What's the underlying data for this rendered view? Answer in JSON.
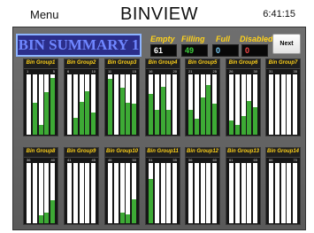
{
  "header": {
    "menu_label": "Menu",
    "title": "BINVIEW",
    "time": "6:41:15"
  },
  "summary": {
    "title": "BIN SUMMARY 1"
  },
  "stats": [
    {
      "label": "Empty",
      "value": "61",
      "color": "#ffffff"
    },
    {
      "label": "Filling",
      "value": "49",
      "color": "#3fd13f"
    },
    {
      "label": "Full",
      "value": "0",
      "color": "#7fd4ff"
    },
    {
      "label": "Disabled",
      "value": "0",
      "color": "#ff4a4a"
    }
  ],
  "next_label": "Next",
  "fill_color": "#3daa35",
  "groups": [
    {
      "name": "Bin Group1",
      "first_bin": "1",
      "last_bin": "5",
      "fill_levels": [
        0,
        0.53,
        0.16,
        0.71,
        0.94
      ]
    },
    {
      "name": "Bin Group2",
      "first_bin": "6",
      "last_bin": "10",
      "fill_levels": [
        0,
        0.28,
        0.54,
        0.72,
        0.37
      ]
    },
    {
      "name": "Bin Group3",
      "first_bin": "11",
      "last_bin": "15",
      "fill_levels": [
        0.93,
        0,
        0.78,
        0.53,
        0.51
      ]
    },
    {
      "name": "Bin Group4",
      "first_bin": "16",
      "last_bin": "20",
      "fill_levels": [
        0.68,
        0.41,
        0.79,
        0.41,
        0
      ]
    },
    {
      "name": "Bin Group5",
      "first_bin": "21",
      "last_bin": "25",
      "fill_levels": [
        0.41,
        0.26,
        0.62,
        0.82,
        0.51
      ]
    },
    {
      "name": "Bin Group6",
      "first_bin": "26",
      "last_bin": "30",
      "fill_levels": [
        0.24,
        0.16,
        0.31,
        0.56,
        0.45
      ]
    },
    {
      "name": "Bin Group7",
      "first_bin": "31",
      "last_bin": "35",
      "fill_levels": [
        0,
        0,
        0,
        0,
        0
      ]
    },
    {
      "name": "Bin Group8",
      "first_bin": "36",
      "last_bin": "40",
      "fill_levels": [
        0,
        0,
        0.13,
        0.18,
        0.38
      ]
    },
    {
      "name": "Bin Group9",
      "first_bin": "41",
      "last_bin": "45",
      "fill_levels": [
        0,
        0,
        0,
        0,
        0
      ]
    },
    {
      "name": "Bin Group10",
      "first_bin": "46",
      "last_bin": "50",
      "fill_levels": [
        0,
        0,
        0.17,
        0.14,
        0.4
      ]
    },
    {
      "name": "Bin Group11",
      "first_bin": "51",
      "last_bin": "55",
      "fill_levels": [
        0.74,
        0,
        0,
        0,
        0
      ]
    },
    {
      "name": "Bin Group12",
      "first_bin": "56",
      "last_bin": "60",
      "fill_levels": [
        0,
        0,
        0,
        0,
        0
      ]
    },
    {
      "name": "Bin Group13",
      "first_bin": "61",
      "last_bin": "65",
      "fill_levels": [
        0,
        0,
        0,
        0,
        0
      ]
    },
    {
      "name": "Bin Group14",
      "first_bin": "66",
      "last_bin": "70",
      "fill_levels": [
        0,
        0,
        0,
        0,
        0
      ]
    }
  ]
}
